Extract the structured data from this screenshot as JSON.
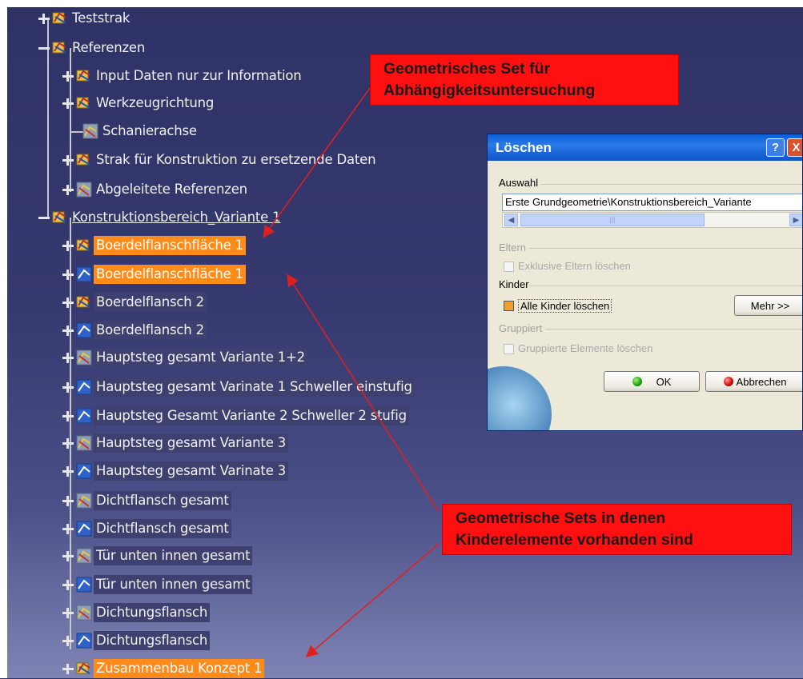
{
  "tree": {
    "items": [
      {
        "label": "Teststrak",
        "style": "plain"
      },
      {
        "label": "Referenzen",
        "style": "plain"
      },
      {
        "label": "Input Daten nur zur Information",
        "style": "plain"
      },
      {
        "label": "Werkzeugrichtung",
        "style": "plain"
      },
      {
        "label": "Schanierachse",
        "style": "plain"
      },
      {
        "label": "Strak für Konstruktion zu ersetzende Daten",
        "style": "plain"
      },
      {
        "label": "Abgeleitete Referenzen",
        "style": "plain"
      },
      {
        "label": "Konstruktionsbereich_Variante 1",
        "style": "underline"
      },
      {
        "label": "Boerdelflanschfläche 1",
        "style": "highlight"
      },
      {
        "label": "Boerdelflanschfläche 1",
        "style": "highlight"
      },
      {
        "label": "Boerdelflansch 2",
        "style": "selected"
      },
      {
        "label": "Boerdelflansch 2",
        "style": "selected"
      },
      {
        "label": "Hauptsteg gesamt Variante 1+2",
        "style": "selected"
      },
      {
        "label": "Hauptsteg gesamt Varinate 1 Schweller einstufig",
        "style": "selected"
      },
      {
        "label": "Hauptsteg Gesamt Variante 2 Schweller 2 stufig",
        "style": "selected"
      },
      {
        "label": "Hauptsteg gesamt Variante 3",
        "style": "selected"
      },
      {
        "label": "Hauptsteg gesamt Varinate 3",
        "style": "selected"
      },
      {
        "label": "Dichtflansch gesamt",
        "style": "selected"
      },
      {
        "label": "Dichtflansch gesamt",
        "style": "selected"
      },
      {
        "label": "Tür unten innen gesamt",
        "style": "selected"
      },
      {
        "label": "Tür unten innen gesamt",
        "style": "selected"
      },
      {
        "label": "Dichtungsflansch",
        "style": "selected"
      },
      {
        "label": "Dichtungsflansch",
        "style": "selected"
      },
      {
        "label": "Zusammenbau Konzept 1",
        "style": "highlight"
      }
    ]
  },
  "callouts": {
    "top": {
      "line1": "Geometrisches Set  für",
      "line2": "Abhängigkeitsuntersuchung"
    },
    "bottom": {
      "line1": "Geometrische Sets in denen",
      "line2": "Kinderelemente vorhanden sind"
    }
  },
  "dialog": {
    "title": "Löschen",
    "help_label": "?",
    "close_label": "X",
    "auswahl_label": "Auswahl",
    "auswahl_value": "Erste Grundgeometrie\\Konstruktionsbereich_Variante",
    "eltern_label": "Eltern",
    "exklusive_label": "Exklusive Eltern löschen",
    "kinder_label": "Kinder",
    "alle_kinder_label": "Alle Kinder löschen",
    "mehr_label": "Mehr >>",
    "gruppiert_label": "Gruppiert",
    "gruppierte_label": "Gruppierte Elemente löschen",
    "ok_label": "OK",
    "abbrechen_label": "Abbrechen"
  },
  "colors": {
    "highlight": "#ff8c1a",
    "callout": "#ff1010",
    "arrow": "#e02020",
    "background": "#36396f"
  }
}
